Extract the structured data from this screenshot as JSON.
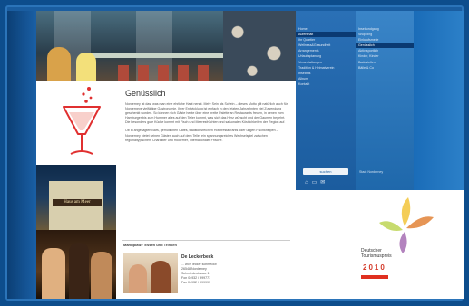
{
  "page": {
    "title": "Genüsslich",
    "paragraphs": [
      "Norderney ist das, was man eine ehrliche Haut nennt. Mehr Sein als Schein – dieses Motto gilt natürlich auch für Norderneys vielfältige Gastronomie. Ihrer Entwicklung ist einfach in den letzten Jahrzehnten viel Zuwendung geschenkt worden. So können sich Gäste heute über eine breite Palette an Restaurants freuen, in denen vom Hamburger bis zum Hummer alles auf den Teller kommt, was sich das Herz wünscht und der Gaumen begehrt. Die besonders gute Küche kommt mit Fisch und Meeresfrüchten und saisonalen Köstlichkeiten der Region auf.",
      "Ob in angesagten Bars, gemütlichen Cafés, traditionsreichen Hotelrestaurants oder urigen Fischkneipen – Norderney bietet seinen Gästen auch auf dem Teller ein spannungsreiches Wechselspiel zwischen regionaltypischem Charakter und moderner, internationaler Frische."
    ],
    "tips_label": "Marktplatz · Essen und Trinken",
    "restaurant": {
      "name": "De Leckerbeck",
      "lines": [
        "... wo's lecker schmeckt!",
        "26548 Norderney",
        "Schmiedestrasse 1",
        "Fon 04932 / 999771",
        "Fax 04932 / 999991"
      ]
    },
    "photo_sign": "Haus am Meer"
  },
  "menu_primary": {
    "items": [
      {
        "label": "Home",
        "active": false
      },
      {
        "label": "Aufenthalt",
        "active": true
      },
      {
        "label": "Ihr Quartier",
        "active": false
      },
      {
        "label": "Wellness&Gesundheit",
        "active": false
      },
      {
        "label": "Arrangements",
        "active": false
      },
      {
        "label": "Urlaubsplanung",
        "active": false
      },
      {
        "label": "Veranstaltungen",
        "active": false
      },
      {
        "label": "Tradition & Heimatverein",
        "active": false
      },
      {
        "label": "Inselbus",
        "active": false
      },
      {
        "label": "Album",
        "active": false
      },
      {
        "label": "Kontakt",
        "active": false
      }
    ],
    "search_label": "suchen",
    "icons": [
      "home-icon",
      "print-icon",
      "mail-icon"
    ]
  },
  "menu_secondary": {
    "items": [
      {
        "label": "Inselrundgang",
        "active": false
      },
      {
        "label": "Shopping",
        "active": false
      },
      {
        "label": "Einkaufsmeile",
        "active": false
      },
      {
        "label": "Genüsslich",
        "active": true
      },
      {
        "label": "Aktiv sportlich",
        "active": false
      },
      {
        "label": "Kinder, Kinder",
        "active": false
      },
      {
        "label": "Badestellen",
        "active": false
      },
      {
        "label": "Bälle & Co",
        "active": false
      }
    ],
    "footer": "Stadt Norderney"
  },
  "ad": {
    "line1": "Deutscher",
    "line2": "Tourismuspreis",
    "year": "2010"
  },
  "colors": {
    "brand_blue": "#1b5c9e",
    "glass_red": "#e03030",
    "award_red": "#d43a2a"
  }
}
